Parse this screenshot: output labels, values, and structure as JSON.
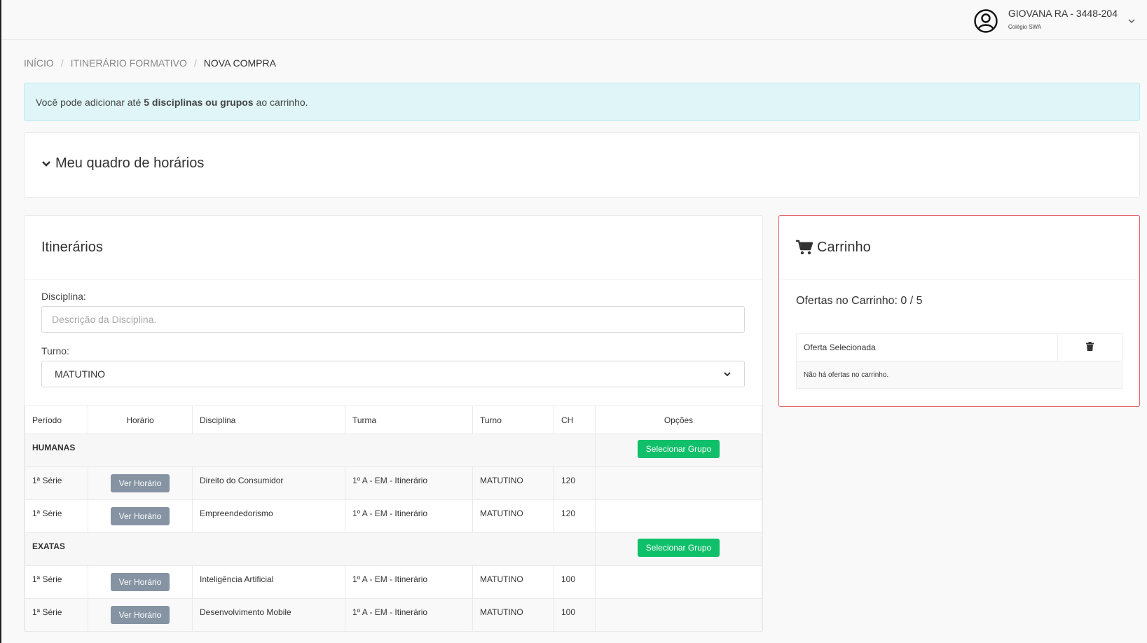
{
  "user": {
    "name": "GIOVANA RA - 3448-204",
    "school": "Colégio SWA"
  },
  "breadcrumb": [
    "INÍCIO",
    "ITINERÁRIO FORMATIVO",
    "NOVA COMPRA"
  ],
  "alert": {
    "prefix": "Você pode adicionar até",
    "bold": "5 disciplinas ou grupos",
    "suffix": "ao carrinho."
  },
  "schedule": {
    "title": "Meu quadro de horários"
  },
  "itinerarios": {
    "title": "Itinerários",
    "disciplina_label": "Disciplina:",
    "disciplina_placeholder": "Descrição da Disciplina.",
    "turno_label": "Turno:",
    "turno_value": "MATUTINO",
    "columns": [
      "Período",
      "Horário",
      "Disciplina",
      "Turma",
      "Turno",
      "CH",
      "Opções"
    ],
    "groups": [
      {
        "name": "HUMANAS",
        "action": "Selecionar Grupo",
        "rows": [
          {
            "periodo": "1ª Série",
            "horario_btn": "Ver Horário",
            "disciplina": "Direito do Consumidor",
            "turma": "1º A - EM - Itinerário",
            "turno": "MATUTINO",
            "ch": "120"
          },
          {
            "periodo": "1ª Série",
            "horario_btn": "Ver Horário",
            "disciplina": "Empreendedorismo",
            "turma": "1º A - EM - Itinerário",
            "turno": "MATUTINO",
            "ch": "120"
          }
        ]
      },
      {
        "name": "EXATAS",
        "action": "Selecionar Grupo",
        "rows": [
          {
            "periodo": "1ª Série",
            "horario_btn": "Ver Horário",
            "disciplina": "Inteligência Artificial",
            "turma": "1º A - EM - Itinerário",
            "turno": "MATUTINO",
            "ch": "100"
          },
          {
            "periodo": "1ª Série",
            "horario_btn": "Ver Horário",
            "disciplina": "Desenvolvimento Mobile",
            "turma": "1º A - EM - Itinerário",
            "turno": "MATUTINO",
            "ch": "100"
          }
        ]
      }
    ]
  },
  "cart": {
    "title": "Carrinho",
    "count_text": "Ofertas no Carrinho: 0 / 5",
    "column": "Oferta Selecionada",
    "empty_text": "Não há ofertas no carrinho."
  },
  "colors": {
    "accent_green": "#0fbf6a",
    "button_gray": "#8593a3",
    "alert_bg": "#dff5f8",
    "cart_border": "#e25c65"
  }
}
